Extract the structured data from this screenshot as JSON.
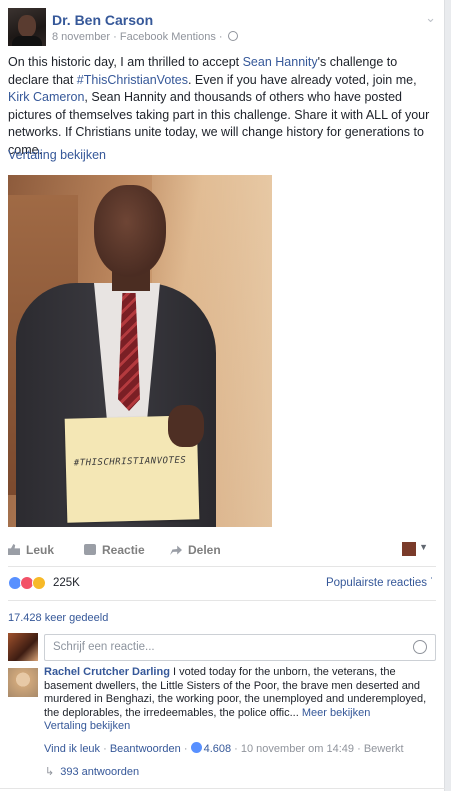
{
  "post": {
    "author": "Dr. Ben Carson",
    "meta": "8 november · Facebook Mentions ·",
    "text_1": "On this historic day, I am thrilled to accept ",
    "text_link_1": "Sean Hannity",
    "text_2": "'s challenge to declare that ",
    "text_link_2": "#ThisChristianVotes",
    "text_3": ". Even if you have already voted, join me, ",
    "text_link_3": "Kirk Cameron",
    "text_4": ", Sean Hannity and thousands of others who have posted pictures of themselves taking part in this challenge. Share it with ALL of your networks. If Christians unite today, we will change history for generations to come.",
    "translate": "Vertaling bekijken",
    "photo_sign": "#THISCHRISTIANVOTES"
  },
  "actions": {
    "like": "Leuk",
    "comment": "Reactie",
    "share": "Delen"
  },
  "reactions": {
    "count": "225K",
    "popular": "Populairste reacties"
  },
  "shares": "17.428 keer gedeeld",
  "comment_box": {
    "placeholder": "Schrijf een reactie..."
  },
  "comment": {
    "author": "Rachel Crutcher Darling",
    "text": "I voted today for the unborn, the veterans, the basement dwellers, the Little Sisters of the Poor, the brave men deserted and murdered in Benghazi, the working poor, the unemployed and underemployed, the deplorables, the irredeemables, the police offic...",
    "more": "Meer bekijken",
    "translate": "Vertaling bekijken",
    "like": "Vind ik leuk",
    "reply": "Beantwoorden",
    "likes": "4.608",
    "time": "10 november om 14:49",
    "edited": "Bewerkt",
    "replies": "393 antwoorden"
  },
  "colors": {
    "link": "#365899",
    "meta": "#90949c",
    "like_reaction": "#5890ff",
    "love_reaction": "#f25268",
    "haha_reaction": "#f7b928"
  }
}
